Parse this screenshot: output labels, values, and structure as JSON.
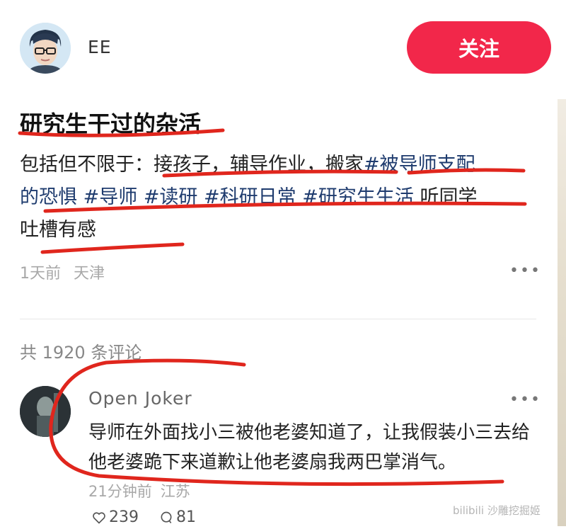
{
  "post": {
    "author": "EE",
    "follow_label": "关注",
    "title": "研究生干过的杂活",
    "body_line1_prefix": "包括但不限于：",
    "body_line1_chores": "接孩子，辅导作业，搬家",
    "body_line1_tag": "#被导师支配",
    "body_line2_tagtail": "的恐惧",
    "tags": [
      "#导师",
      "#读研",
      "#科研日常",
      "#研究生生活"
    ],
    "body_line2_suffix": "听同学",
    "body_line3": "吐槽有感",
    "time_ago": "1天前",
    "location": "天津"
  },
  "comments_header": "共 1920 条评论",
  "comment": {
    "user": "Open Joker",
    "text": "导师在外面找小三被他老婆知道了，让我假装小三去给他老婆跪下来道歉让他老婆扇我两巴掌消气。",
    "time_ago": "21分钟前",
    "location": "江苏",
    "likes": "239",
    "replies": "81"
  },
  "watermark": "bilibili 沙雕挖掘姬",
  "colors": {
    "follow": "#f2274a",
    "tag": "#1e3b6e",
    "annotation": "#e0261d"
  },
  "icons": {
    "more": "more-dots-icon",
    "like": "heart-icon",
    "reply": "comment-bubble-icon"
  }
}
